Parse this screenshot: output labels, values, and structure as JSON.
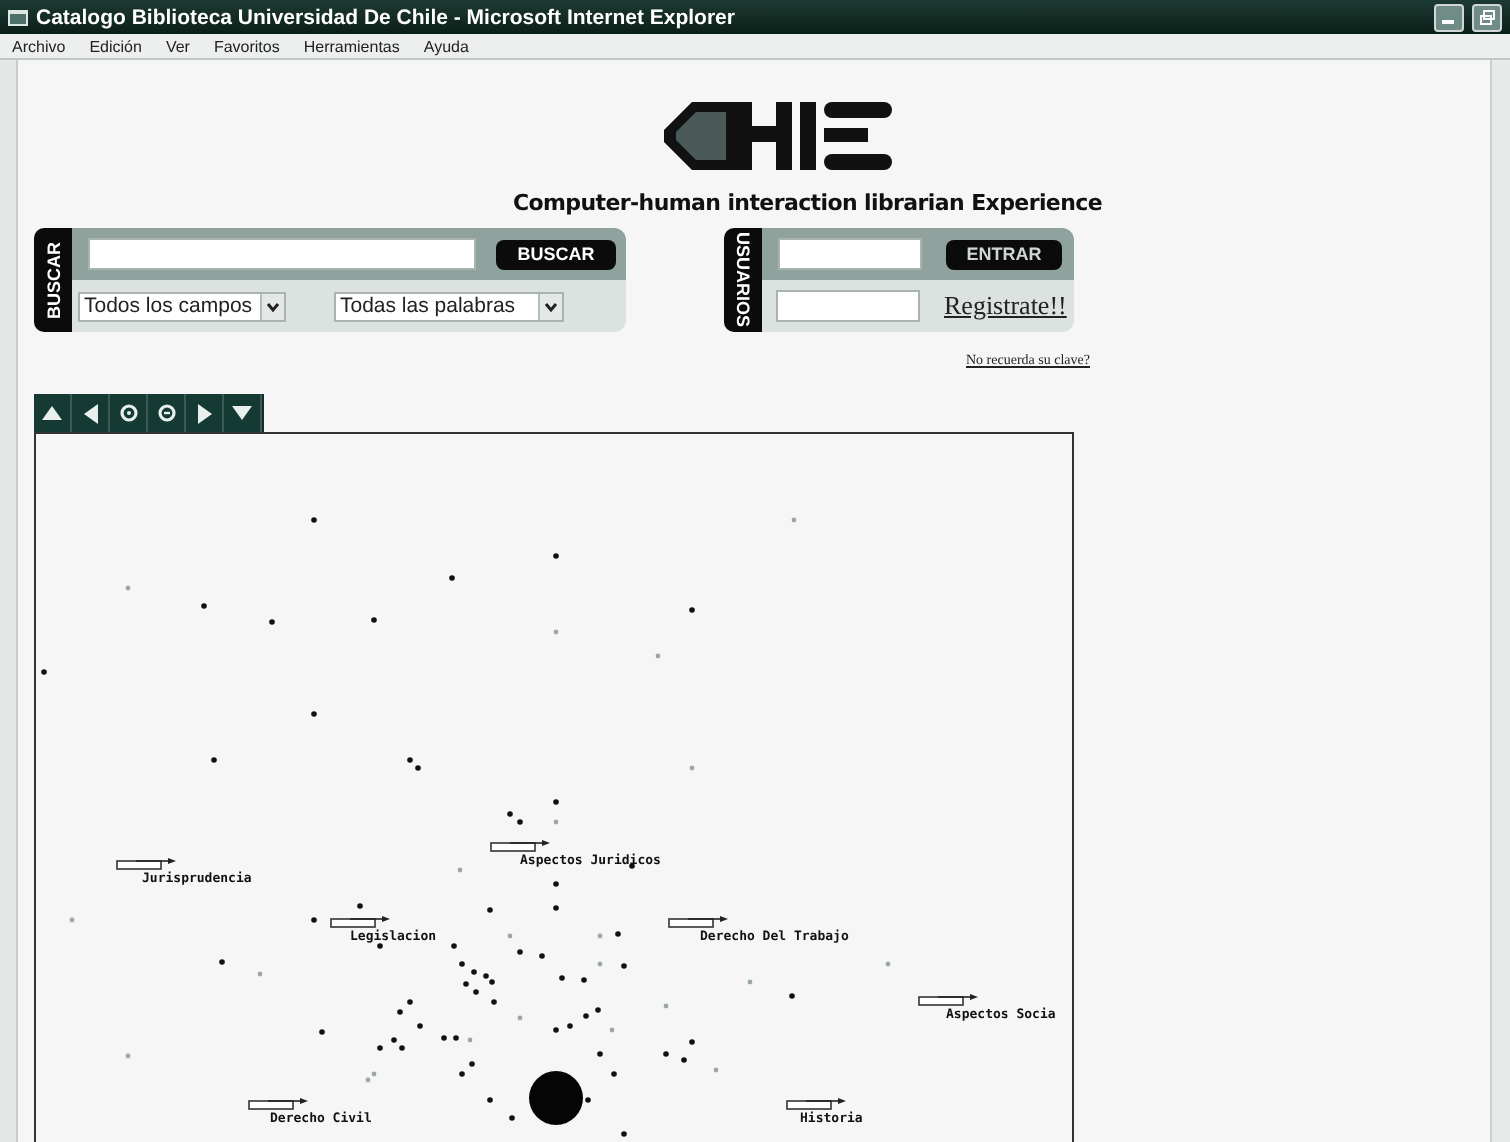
{
  "window": {
    "title": "Catalogo Biblioteca Universidad De Chile - Microsoft Internet Explorer"
  },
  "menu": [
    "Archivo",
    "Edición",
    "Ver",
    "Favoritos",
    "Herramientas",
    "Ayuda"
  ],
  "header": {
    "tagline": "Computer-human interaction librarian Experience"
  },
  "search": {
    "tab_label": "BUSCAR",
    "button": "BUSCAR",
    "field_select": "Todos los campos",
    "words_select": "Todas las palabras"
  },
  "users": {
    "tab_label": "USUARIOS",
    "button": "ENTRAR",
    "register_link": "Registrate!!",
    "forgot_link": "No recuerda su clave?"
  },
  "graph_toolbar": [
    {
      "kind": "up"
    },
    {
      "kind": "left"
    },
    {
      "kind": "zoom_in"
    },
    {
      "kind": "zoom_out"
    },
    {
      "kind": "right"
    },
    {
      "kind": "down"
    }
  ],
  "graph": {
    "labels": [
      "Jurisprudencia",
      "Aspectos Juridicos",
      "Legislacion",
      "Derecho Del Trabajo",
      "Aspectos Socia",
      "Derecho Civil",
      "Historia"
    ]
  }
}
